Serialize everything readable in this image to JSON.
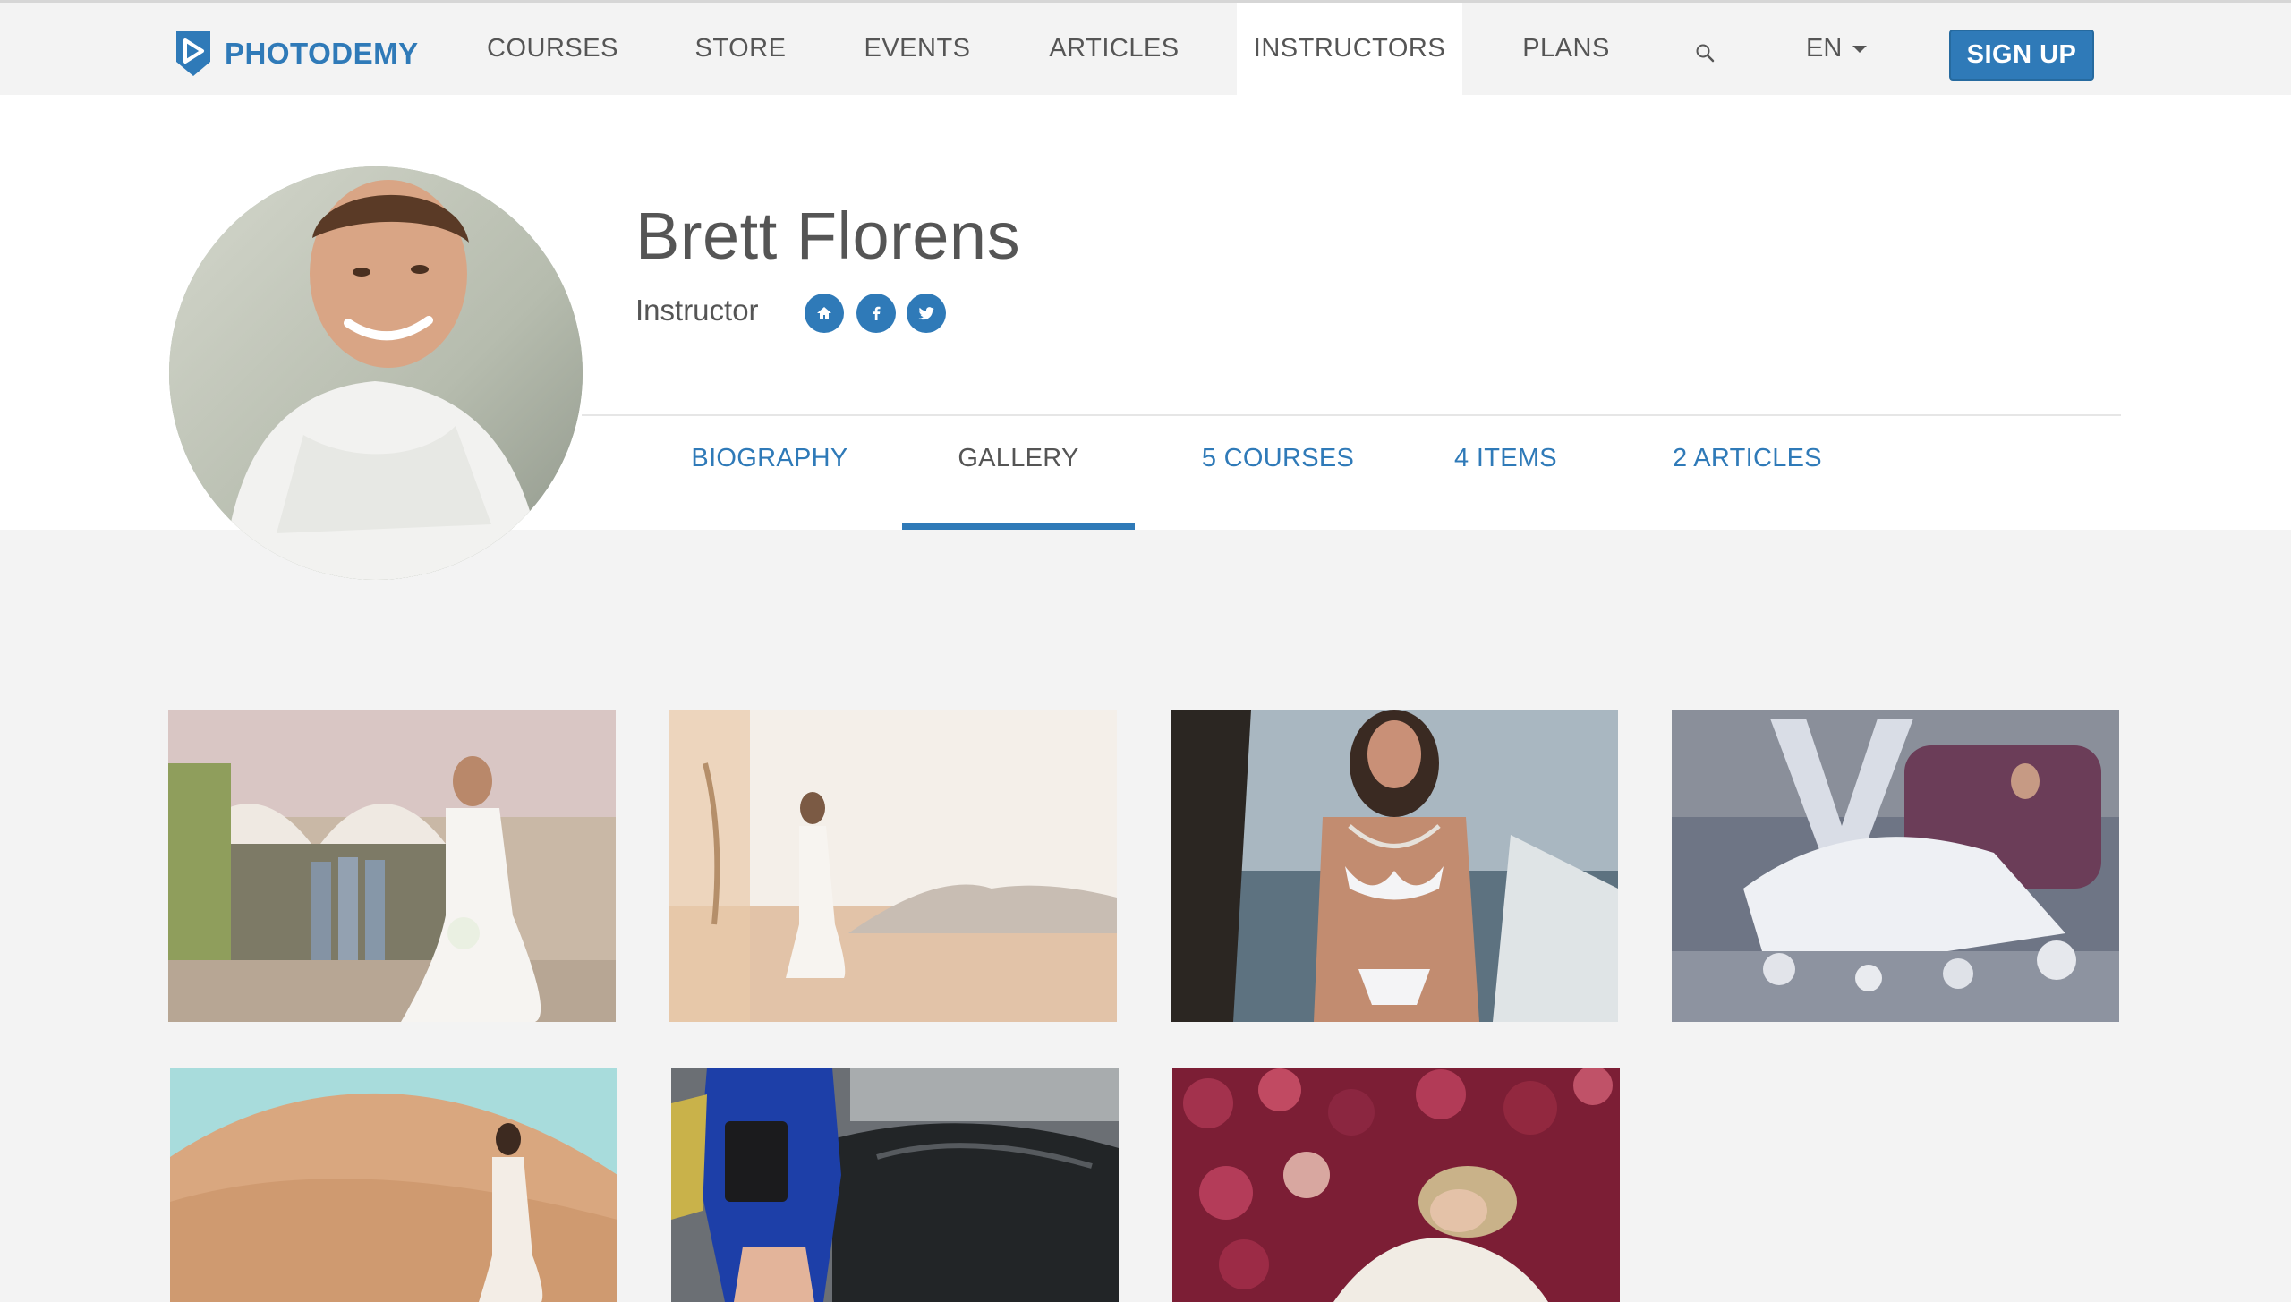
{
  "brand": {
    "name": "PHOTODEMY"
  },
  "nav": {
    "items": [
      {
        "label": "COURSES"
      },
      {
        "label": "STORE"
      },
      {
        "label": "EVENTS"
      },
      {
        "label": "ARTICLES"
      },
      {
        "label": "INSTRUCTORS",
        "active": true
      },
      {
        "label": "PLANS"
      }
    ],
    "language": "EN",
    "signup_label": "SIGN UP"
  },
  "profile": {
    "name": "Brett Florens",
    "role": "Instructor",
    "social": [
      "home-icon",
      "facebook-icon",
      "twitter-icon"
    ]
  },
  "tabs": [
    {
      "label": "BIOGRAPHY"
    },
    {
      "label": "GALLERY",
      "active": true
    },
    {
      "label": "5 COURSES"
    },
    {
      "label": "4 ITEMS"
    },
    {
      "label": "2 ARTICLES"
    }
  ],
  "gallery": {
    "items": [
      {
        "subject": "bride-courtyard"
      },
      {
        "subject": "bride-desert-haze"
      },
      {
        "subject": "model-yacht"
      },
      {
        "subject": "bride-purple-couch"
      },
      {
        "subject": "bride-sand-dunes"
      },
      {
        "subject": "fashion-car"
      },
      {
        "subject": "bride-roses"
      }
    ]
  },
  "colors": {
    "accent": "#2f7ab8",
    "nav_bg": "#f3f3f3",
    "page_bg": "#f3f3f3",
    "header_bg": "#ffffff",
    "text": "#555555"
  }
}
